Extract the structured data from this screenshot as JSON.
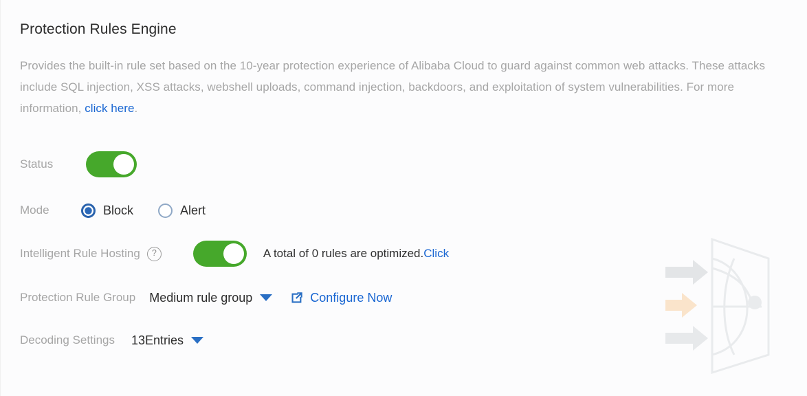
{
  "page": {
    "title": "Protection Rules Engine",
    "description_part1": "Provides the built-in rule set based on the 10-year protection experience of Alibaba Cloud to guard against common web attacks. These attacks include SQL injection, XSS attacks, webshell uploads, command injection, backdoors, and exploitation of system vulnerabilities. For more information, ",
    "description_link": "click here",
    "description_part2": "."
  },
  "status": {
    "label": "Status",
    "toggle_state": "on"
  },
  "mode": {
    "label": "Mode",
    "options": [
      {
        "label": "Block",
        "selected": true
      },
      {
        "label": "Alert",
        "selected": false
      }
    ]
  },
  "hosting": {
    "label": "Intelligent Rule Hosting",
    "help_icon": "question-mark-circle-icon",
    "toggle_state": "on",
    "note_text": "A total of 0 rules are optimized.",
    "note_link": "Click"
  },
  "rule_group": {
    "label": "Protection Rule Group",
    "selected_value": "Medium rule group",
    "dropdown_icon": "chevron-down-icon",
    "configure_icon": "external-link-icon",
    "configure_label": "Configure Now"
  },
  "decoding": {
    "label": "Decoding Settings",
    "selected_value": "13Entries",
    "dropdown_icon": "chevron-down-icon"
  },
  "colors": {
    "toggle_on": "#46a82b",
    "link": "#1966d2",
    "radio_selected": "#2a68b8",
    "label_text": "#a6a6a6",
    "value_text": "#2d2d2d",
    "accent_arrow": "#f7dcc0",
    "watermark_line": "#e9ebed",
    "background": "#fcfcfd"
  },
  "watermark": {
    "name": "shield-globe-arrows-watermark",
    "arrows": [
      "gray",
      "orange",
      "gray"
    ]
  }
}
